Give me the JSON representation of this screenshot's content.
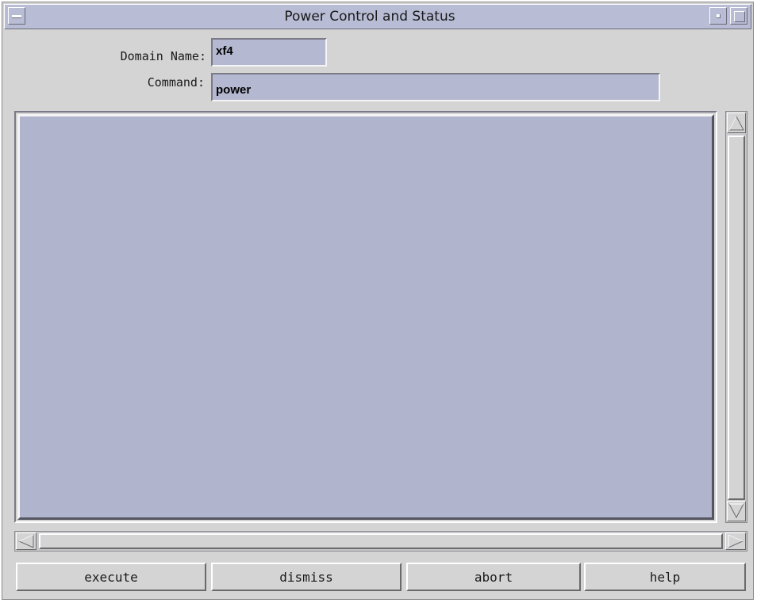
{
  "window": {
    "title": "Power Control and Status"
  },
  "form": {
    "domain_label": "Domain Name:",
    "domain_value": "xf4",
    "command_label": "Command:",
    "command_value": "power"
  },
  "output": {
    "text": ""
  },
  "buttons": {
    "execute": "execute",
    "dismiss": "dismiss",
    "abort": "abort",
    "help": "help"
  },
  "icons": {
    "window_menu": "window-menu-icon",
    "minimize": "minimize-icon",
    "maximize": "maximize-icon",
    "scroll_up": "arrow-up-icon",
    "scroll_down": "arrow-down-icon",
    "scroll_left": "arrow-left-icon",
    "scroll_right": "arrow-right-icon"
  },
  "colors": {
    "titlebar": "#b8bcd4",
    "field_bg": "#b4b8d0",
    "output_bg": "#b0b4cc",
    "panel_bg": "#d4d4d4"
  }
}
